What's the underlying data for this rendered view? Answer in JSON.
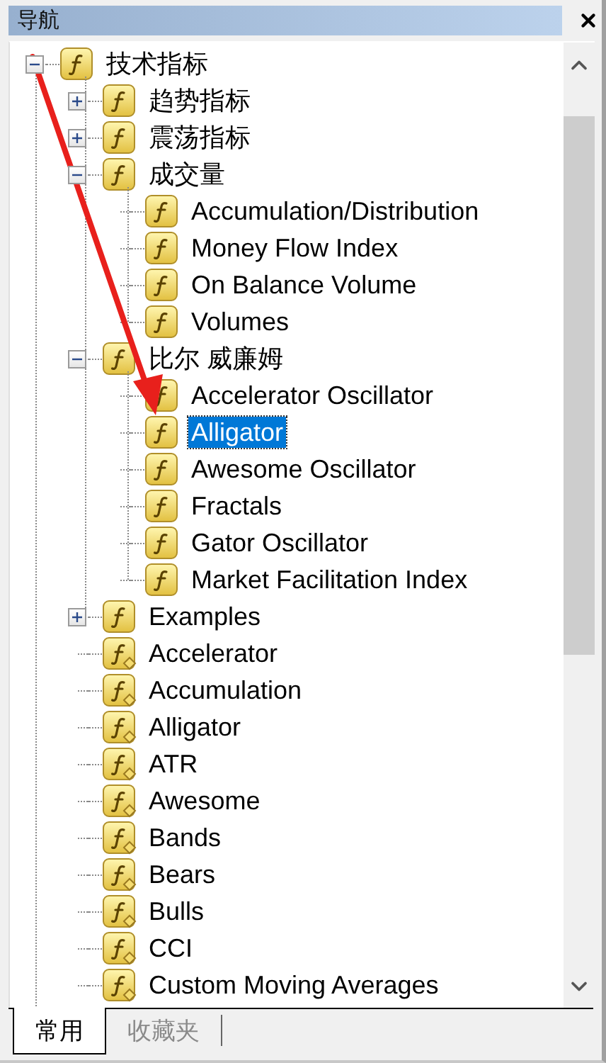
{
  "panel": {
    "title": "导航"
  },
  "tree": [
    {
      "label": "技术指标",
      "kind": "indicator",
      "expanded": true,
      "selected": false,
      "children": [
        {
          "label": "趋势指标",
          "kind": "indicator",
          "expanded": false,
          "selected": false
        },
        {
          "label": "震荡指标",
          "kind": "indicator",
          "expanded": false,
          "selected": false
        },
        {
          "label": "成交量",
          "kind": "indicator",
          "expanded": true,
          "selected": false,
          "children": [
            {
              "label": "Accumulation/Distribution",
              "kind": "indicator",
              "selected": false
            },
            {
              "label": "Money Flow Index",
              "kind": "indicator",
              "selected": false
            },
            {
              "label": "On Balance Volume",
              "kind": "indicator",
              "selected": false
            },
            {
              "label": "Volumes",
              "kind": "indicator",
              "selected": false
            }
          ]
        },
        {
          "label": "比尔 威廉姆",
          "kind": "indicator",
          "expanded": true,
          "selected": false,
          "children": [
            {
              "label": "Accelerator Oscillator",
              "kind": "indicator",
              "selected": false
            },
            {
              "label": "Alligator",
              "kind": "indicator",
              "selected": true
            },
            {
              "label": "Awesome Oscillator",
              "kind": "indicator",
              "selected": false
            },
            {
              "label": "Fractals",
              "kind": "indicator",
              "selected": false
            },
            {
              "label": "Gator Oscillator",
              "kind": "indicator",
              "selected": false
            },
            {
              "label": "Market Facilitation Index",
              "kind": "indicator",
              "selected": false
            }
          ]
        },
        {
          "label": "Examples",
          "kind": "indicator",
          "expanded": false,
          "selected": false
        },
        {
          "label": "Accelerator",
          "kind": "custom",
          "selected": false
        },
        {
          "label": "Accumulation",
          "kind": "custom",
          "selected": false
        },
        {
          "label": "Alligator",
          "kind": "custom",
          "selected": false
        },
        {
          "label": "ATR",
          "kind": "custom",
          "selected": false
        },
        {
          "label": "Awesome",
          "kind": "custom",
          "selected": false
        },
        {
          "label": "Bands",
          "kind": "custom",
          "selected": false
        },
        {
          "label": "Bears",
          "kind": "custom",
          "selected": false
        },
        {
          "label": "Bulls",
          "kind": "custom",
          "selected": false
        },
        {
          "label": "CCI",
          "kind": "custom",
          "selected": false
        },
        {
          "label": "Custom Moving Averages",
          "kind": "custom",
          "selected": false
        }
      ]
    }
  ],
  "tabs": [
    {
      "label": "常用",
      "selected": true
    },
    {
      "label": "收藏夹",
      "selected": false
    }
  ]
}
